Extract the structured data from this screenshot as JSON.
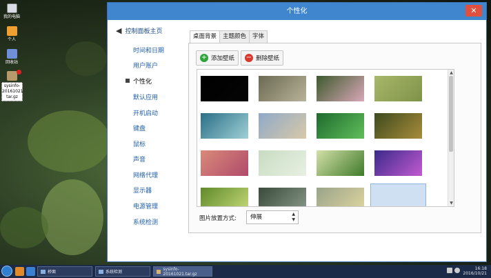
{
  "desktop": {
    "icons": [
      {
        "label": "我的电脑",
        "icon": "computer-icon"
      },
      {
        "label": "个人",
        "icon": "home-folder-icon"
      },
      {
        "label": "回收站",
        "icon": "recycle-bin-icon"
      },
      {
        "label": "sysinfo-20161021.tar.gz",
        "label_lines": [
          "sysinfo-",
          "20161021.",
          "tar.gz"
        ],
        "icon": "archive-icon"
      }
    ]
  },
  "window": {
    "title": "个性化",
    "close_label": "✕",
    "sidebar": {
      "home_label": "控制面板主页",
      "items": [
        {
          "label": "时间和日期"
        },
        {
          "label": "用户账户"
        },
        {
          "label": "个性化",
          "active": true
        },
        {
          "label": "默认应用"
        },
        {
          "label": "开机启动"
        },
        {
          "label": "键盘"
        },
        {
          "label": "鼠标"
        },
        {
          "label": "声音"
        },
        {
          "label": "网络代理"
        },
        {
          "label": "显示器"
        },
        {
          "label": "电源管理"
        },
        {
          "label": "系统检测"
        }
      ]
    },
    "tabs": [
      {
        "label": "桌面背景",
        "active": true
      },
      {
        "label": "主题颜色"
      },
      {
        "label": "字体"
      }
    ],
    "buttons": {
      "add_label": "添加壁纸",
      "remove_label": "删除壁纸"
    },
    "wallpapers": [
      {
        "name": "black",
        "colors": [
          "#000000",
          "#050505"
        ],
        "selected": false
      },
      {
        "name": "wood-steps",
        "colors": [
          "#6b6a52",
          "#b9b29a"
        ],
        "selected": false
      },
      {
        "name": "pink-flowers",
        "colors": [
          "#3d5a2d",
          "#d9a7b8"
        ],
        "selected": false
      },
      {
        "name": "green-field",
        "colors": [
          "#a8b86a",
          "#7e9248"
        ],
        "selected": false
      },
      {
        "name": "spiral-road",
        "colors": [
          "#2a6f86",
          "#9fd0d6"
        ],
        "selected": false
      },
      {
        "name": "beach",
        "colors": [
          "#8fa9c9",
          "#d8c9a8"
        ],
        "selected": false
      },
      {
        "name": "bamboo-flower",
        "colors": [
          "#1f6a2e",
          "#5fbf5a"
        ],
        "selected": false
      },
      {
        "name": "bird",
        "colors": [
          "#3d4a1f",
          "#a88c3a"
        ],
        "selected": false
      },
      {
        "name": "petals",
        "colors": [
          "#d98a7a",
          "#b04a6a"
        ],
        "selected": false
      },
      {
        "name": "dandelion",
        "colors": [
          "#c8dcc2",
          "#e8f0e2"
        ],
        "selected": false
      },
      {
        "name": "sunset-field",
        "colors": [
          "#d3e0a8",
          "#3f7a2a"
        ],
        "selected": false
      },
      {
        "name": "purple-flare",
        "colors": [
          "#3a2a8a",
          "#c25ad0"
        ],
        "selected": false
      },
      {
        "name": "fern",
        "colors": [
          "#5f8a2a",
          "#c7da7a"
        ],
        "selected": false
      },
      {
        "name": "water-surface",
        "colors": [
          "#3a4a3a",
          "#8a9a8a"
        ],
        "selected": false
      },
      {
        "name": "yellow-rose",
        "colors": [
          "#9aa48a",
          "#e0d6a0"
        ],
        "selected": false
      },
      {
        "name": "forest-moss",
        "colors": [
          "#3d4a2a",
          "#7a8a5a"
        ],
        "selected": true
      }
    ],
    "placement_label": "图片放置方式:",
    "placement_value": "伸展"
  },
  "taskbar": {
    "items": [
      {
        "label": "桥面",
        "icon": "desktop-window-icon"
      },
      {
        "label": "系统检测",
        "icon": "system-check-icon"
      },
      {
        "label": "sysinfo-20161021.tar.gz",
        "icon": "archive-icon"
      }
    ],
    "time": "16:18",
    "date": "2016/10/21"
  },
  "colors": {
    "titlebar": "#3f86cf",
    "close": "#e0503f",
    "taskbar": "#1b2a47",
    "link": "#1f5ea8"
  }
}
